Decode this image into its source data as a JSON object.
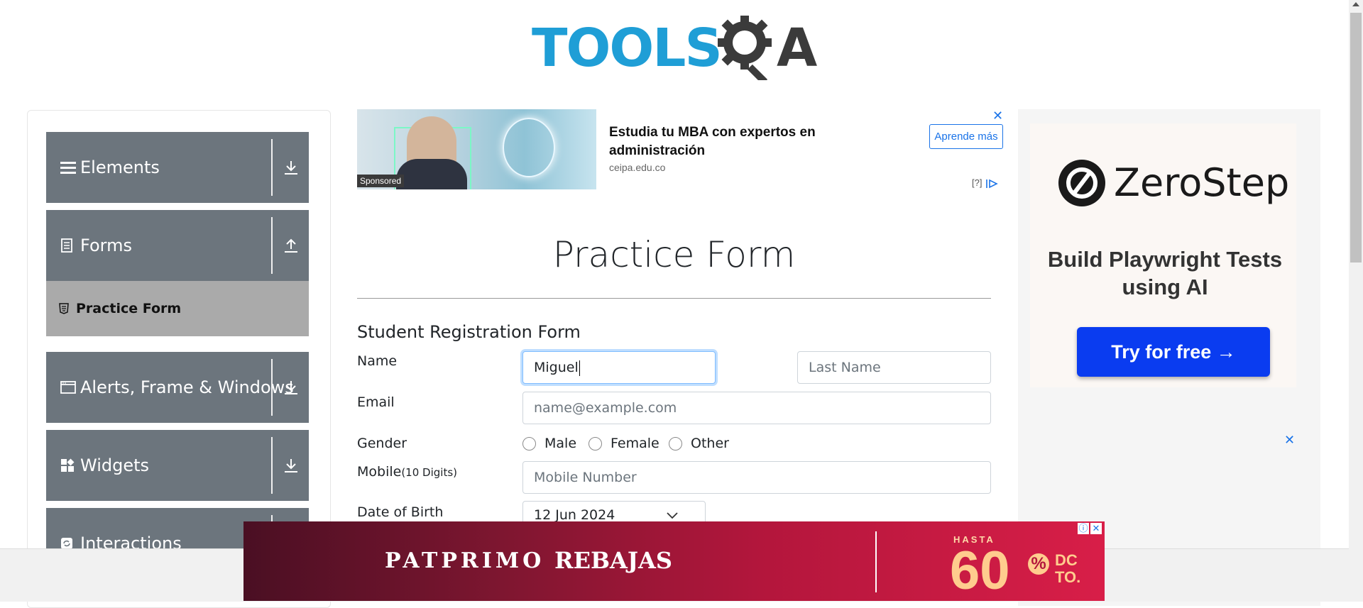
{
  "header": {
    "logo_text_left": "TOOLS",
    "logo_text_right": "A"
  },
  "sidebar": {
    "groups": [
      {
        "label": "Elements",
        "icon": "menu-icon",
        "toggle": "download-icon"
      },
      {
        "label": "Forms",
        "icon": "document-icon",
        "toggle": "upload-icon"
      },
      {
        "label": "Alerts, Frame & Windows",
        "icon": "window-icon",
        "toggle": "download-icon"
      },
      {
        "label": "Widgets",
        "icon": "widgets-icon",
        "toggle": "download-icon"
      },
      {
        "label": "Interactions",
        "icon": "refresh-icon",
        "toggle": "download-icon"
      }
    ],
    "active_item": {
      "label": "Practice Form",
      "icon": "html5-icon"
    }
  },
  "top_ad": {
    "sponsored_label": "Sponsored",
    "headline": "Estudia tu MBA con expertos en administración",
    "domain": "ceipa.edu.co",
    "cta": "Aprende más",
    "info": "[?]"
  },
  "form": {
    "page_title": "Practice Form",
    "section_title": "Student Registration Form",
    "name_label": "Name",
    "first_name_value": "Miguel",
    "last_name_placeholder": "Last Name",
    "email_label": "Email",
    "email_placeholder": "name@example.com",
    "gender_label": "Gender",
    "gender_options": [
      "Male",
      "Female",
      "Other"
    ],
    "mobile_label": "Mobile",
    "mobile_hint": "(10 Digits)",
    "mobile_placeholder": "Mobile Number",
    "dob_label": "Date of Birth",
    "dob_value": "12 Jun 2024"
  },
  "right_ad": {
    "brand": "ZeroStep",
    "tagline": "Build Playwright Tests using AI",
    "cta": "Try for free →"
  },
  "bottom_ad": {
    "brand_1": "PATPRIMO",
    "brand_2": "REBAJAS",
    "prefix": "HASTA",
    "discount": "60",
    "percent": "%",
    "suffix": "DC TO."
  },
  "colors": {
    "sidebar_group_bg": "#6c757d",
    "sidebar_active_bg": "#aaaaaa",
    "logo_blue": "#1f9ed6",
    "logo_dark": "#3b3b3b",
    "ad_cta_blue": "#0a3cf0"
  }
}
